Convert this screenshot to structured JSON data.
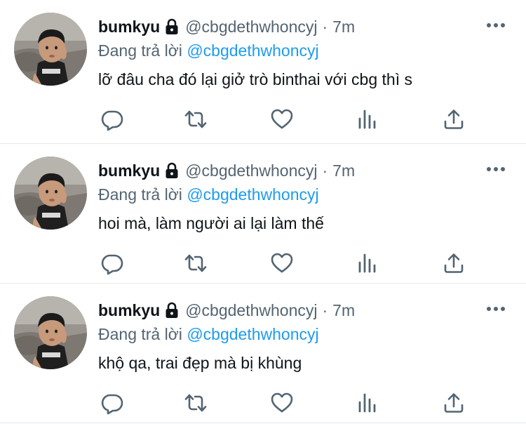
{
  "colors": {
    "link": "#1d9bf0",
    "secondary_text": "#536471",
    "primary_text": "#0f1419",
    "divider": "#e6e9ec"
  },
  "icons": {
    "lock": "lock-icon",
    "more": "more-icon",
    "reply": "reply-icon",
    "retweet": "retweet-icon",
    "like": "like-icon",
    "views": "views-icon",
    "share": "share-icon"
  },
  "tweets": [
    {
      "display_name": "bumkyu",
      "handle": "@cbgdethwhoncyj",
      "separator": "·",
      "time": "7m",
      "reply_prefix": "Đang trả lời",
      "reply_to": "@cbgdethwhoncyj",
      "text": "lỡ đâu cha đó lại giở trò binthai với cbg thì s"
    },
    {
      "display_name": "bumkyu",
      "handle": "@cbgdethwhoncyj",
      "separator": "·",
      "time": "7m",
      "reply_prefix": "Đang trả lời",
      "reply_to": "@cbgdethwhoncyj",
      "text": "hoi mà, làm người ai lại làm thế"
    },
    {
      "display_name": "bumkyu",
      "handle": "@cbgdethwhoncyj",
      "separator": "·",
      "time": "7m",
      "reply_prefix": "Đang trả lời",
      "reply_to": "@cbgdethwhoncyj",
      "text": "khộ qa, trai đẹp mà bị khùng"
    }
  ]
}
